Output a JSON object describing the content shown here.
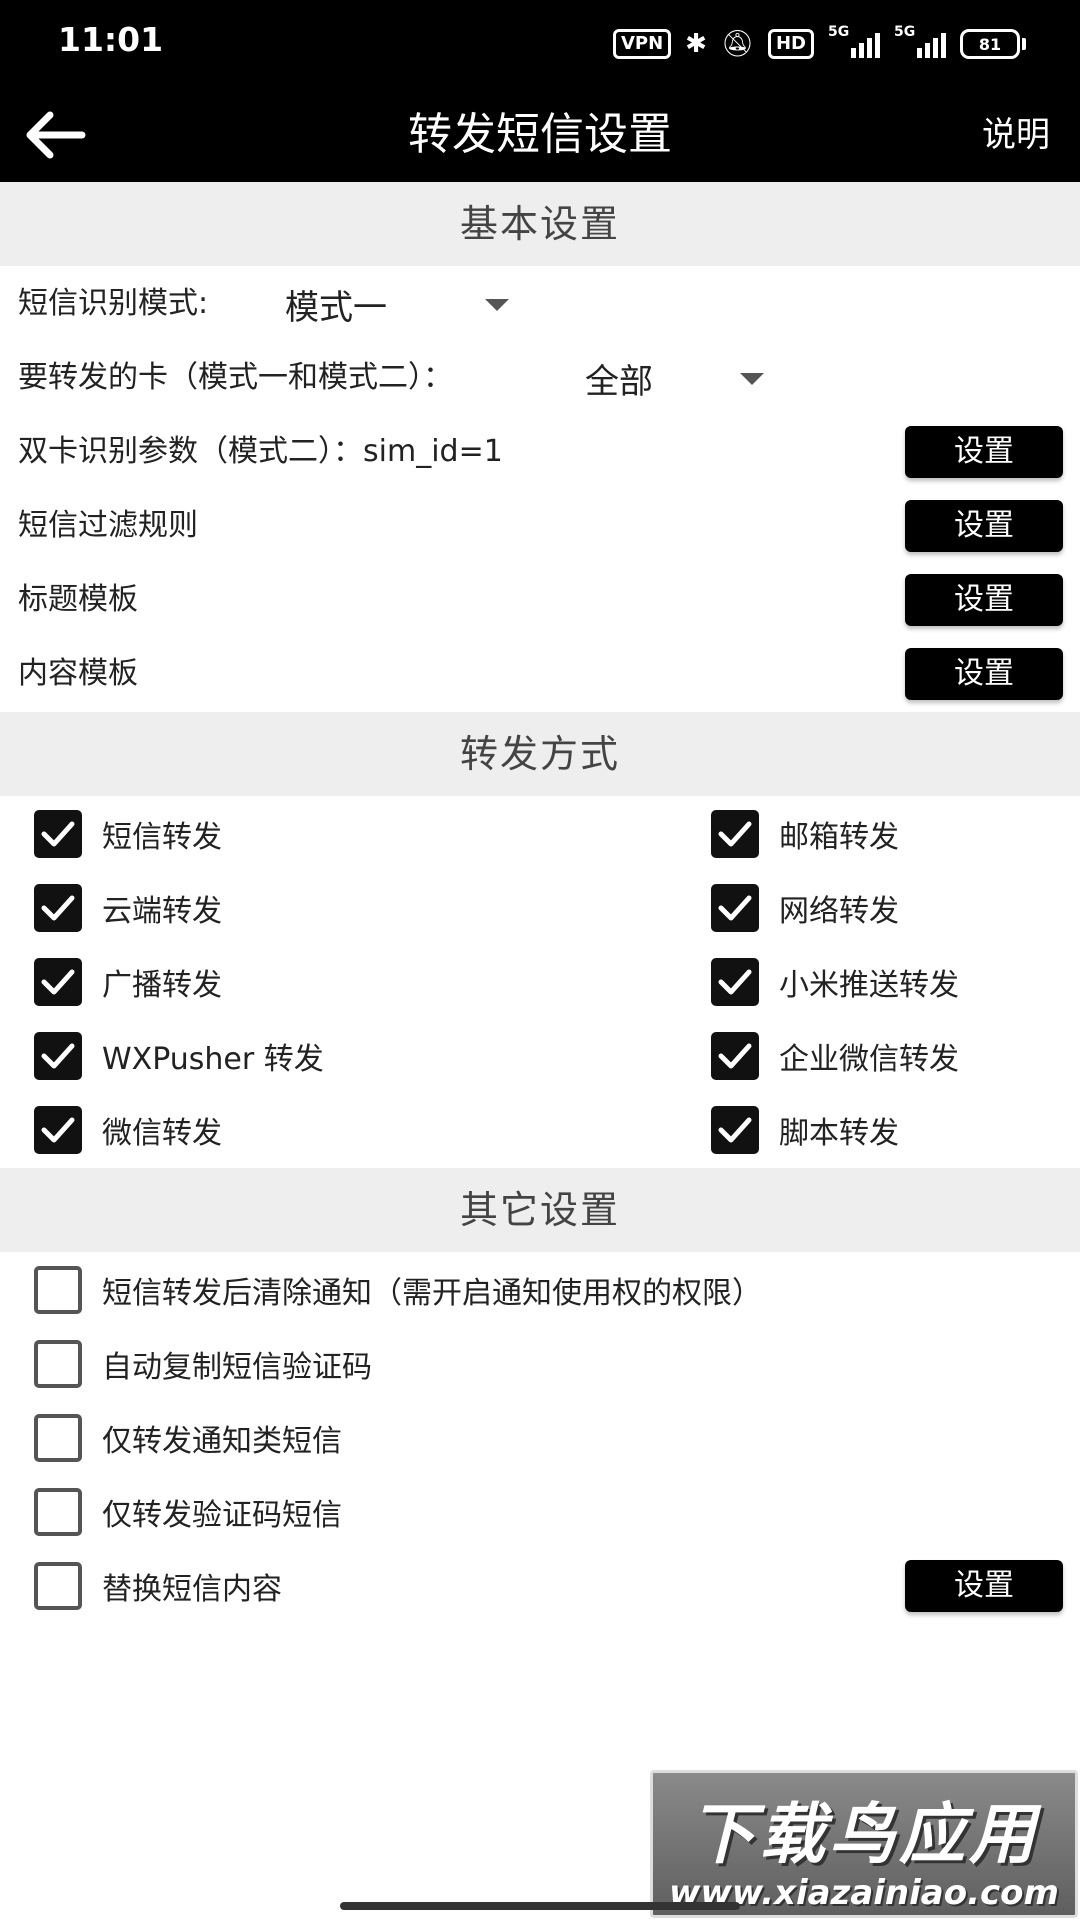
{
  "status_bar": {
    "time": "11:01",
    "vpn": "VPN",
    "hd": "HD",
    "net1": "5G",
    "net2": "5G",
    "battery": "81"
  },
  "app_bar": {
    "title": "转发短信设置",
    "help": "说明"
  },
  "basic": {
    "header": "基本设置",
    "sms_mode_label": "短信识别模式:",
    "sms_mode_value": "模式一",
    "card_label": "要转发的卡（模式一和模式二）：",
    "card_value": "全部",
    "dual_sim_label": "双卡识别参数（模式二）：",
    "dual_sim_value": "sim_id=1",
    "filter_label": "短信过滤规则",
    "title_tpl_label": "标题模板",
    "content_tpl_label": "内容模板",
    "set_label": "设置"
  },
  "forward": {
    "header": "转发方式",
    "left": [
      {
        "label": "短信转发",
        "checked": true
      },
      {
        "label": "云端转发",
        "checked": true
      },
      {
        "label": "广播转发",
        "checked": true
      },
      {
        "label": "WXPusher 转发",
        "checked": true
      },
      {
        "label": "微信转发",
        "checked": true
      }
    ],
    "right": [
      {
        "label": "邮箱转发",
        "checked": true
      },
      {
        "label": "网络转发",
        "checked": true
      },
      {
        "label": "小米推送转发",
        "checked": true
      },
      {
        "label": "企业微信转发",
        "checked": true
      },
      {
        "label": "脚本转发",
        "checked": true
      }
    ]
  },
  "other": {
    "header": "其它设置",
    "items": [
      {
        "label": "短信转发后清除通知（需开启通知使用权的权限）",
        "checked": false
      },
      {
        "label": "自动复制短信验证码",
        "checked": false
      },
      {
        "label": "仅转发通知类短信",
        "checked": false
      },
      {
        "label": "仅转发验证码短信",
        "checked": false
      },
      {
        "label": "替换短信内容",
        "checked": false
      }
    ],
    "set_label": "设置"
  },
  "watermark": {
    "title": "下载鸟应用",
    "url": "www.xiazainiao.com"
  },
  "colors": {
    "bar": "#000000",
    "section_bg": "#eeeeee",
    "button": "#000000"
  }
}
